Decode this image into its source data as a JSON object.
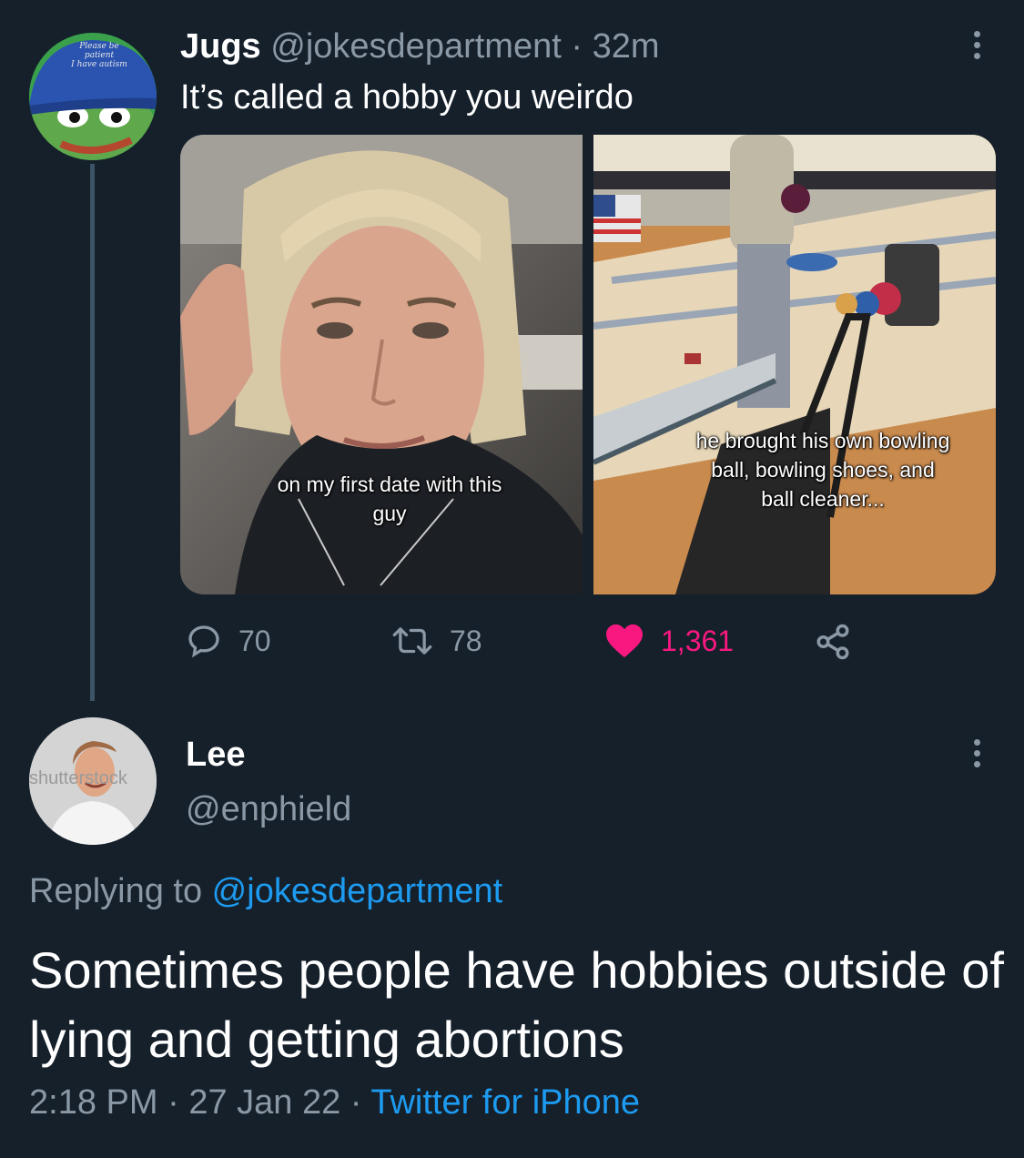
{
  "tweet": {
    "author_name": "Jugs",
    "handle": "@jokesdepartment",
    "separator": " · ",
    "time_ago": "32m",
    "text": "It’s called a hobby you weirdo",
    "avatar_hat_text": [
      "Please be",
      "patient",
      "I have autism"
    ],
    "media": [
      {
        "caption_line1": "on my first date with this",
        "caption_line2": "guy"
      },
      {
        "caption_line1": "he brought his own bowling",
        "caption_line2": "ball, bowling shoes, and",
        "caption_line3": "ball cleaner..."
      }
    ],
    "actions": {
      "reply_count": "70",
      "retweet_count": "78",
      "like_count": "1,361"
    },
    "colors": {
      "like": "#f91880",
      "muted": "#8b98a5",
      "link": "#1d9bf0",
      "background": "#15202b"
    }
  },
  "reply": {
    "author_name": "Lee",
    "handle": "@enphield",
    "avatar_watermark": "shutterstock",
    "replying_prefix": "Replying to ",
    "replying_mention": "@jokesdepartment",
    "text": "Sometimes people have hobbies outside of lying and getting abortions",
    "time": "2:18 PM",
    "separator": " · ",
    "date": "27 Jan 22",
    "source": "Twitter for iPhone"
  },
  "icons": {
    "reply": "comment-icon",
    "retweet": "retweet-icon",
    "like": "heart-icon",
    "share": "share-icon",
    "more": "more-vertical-icon"
  }
}
